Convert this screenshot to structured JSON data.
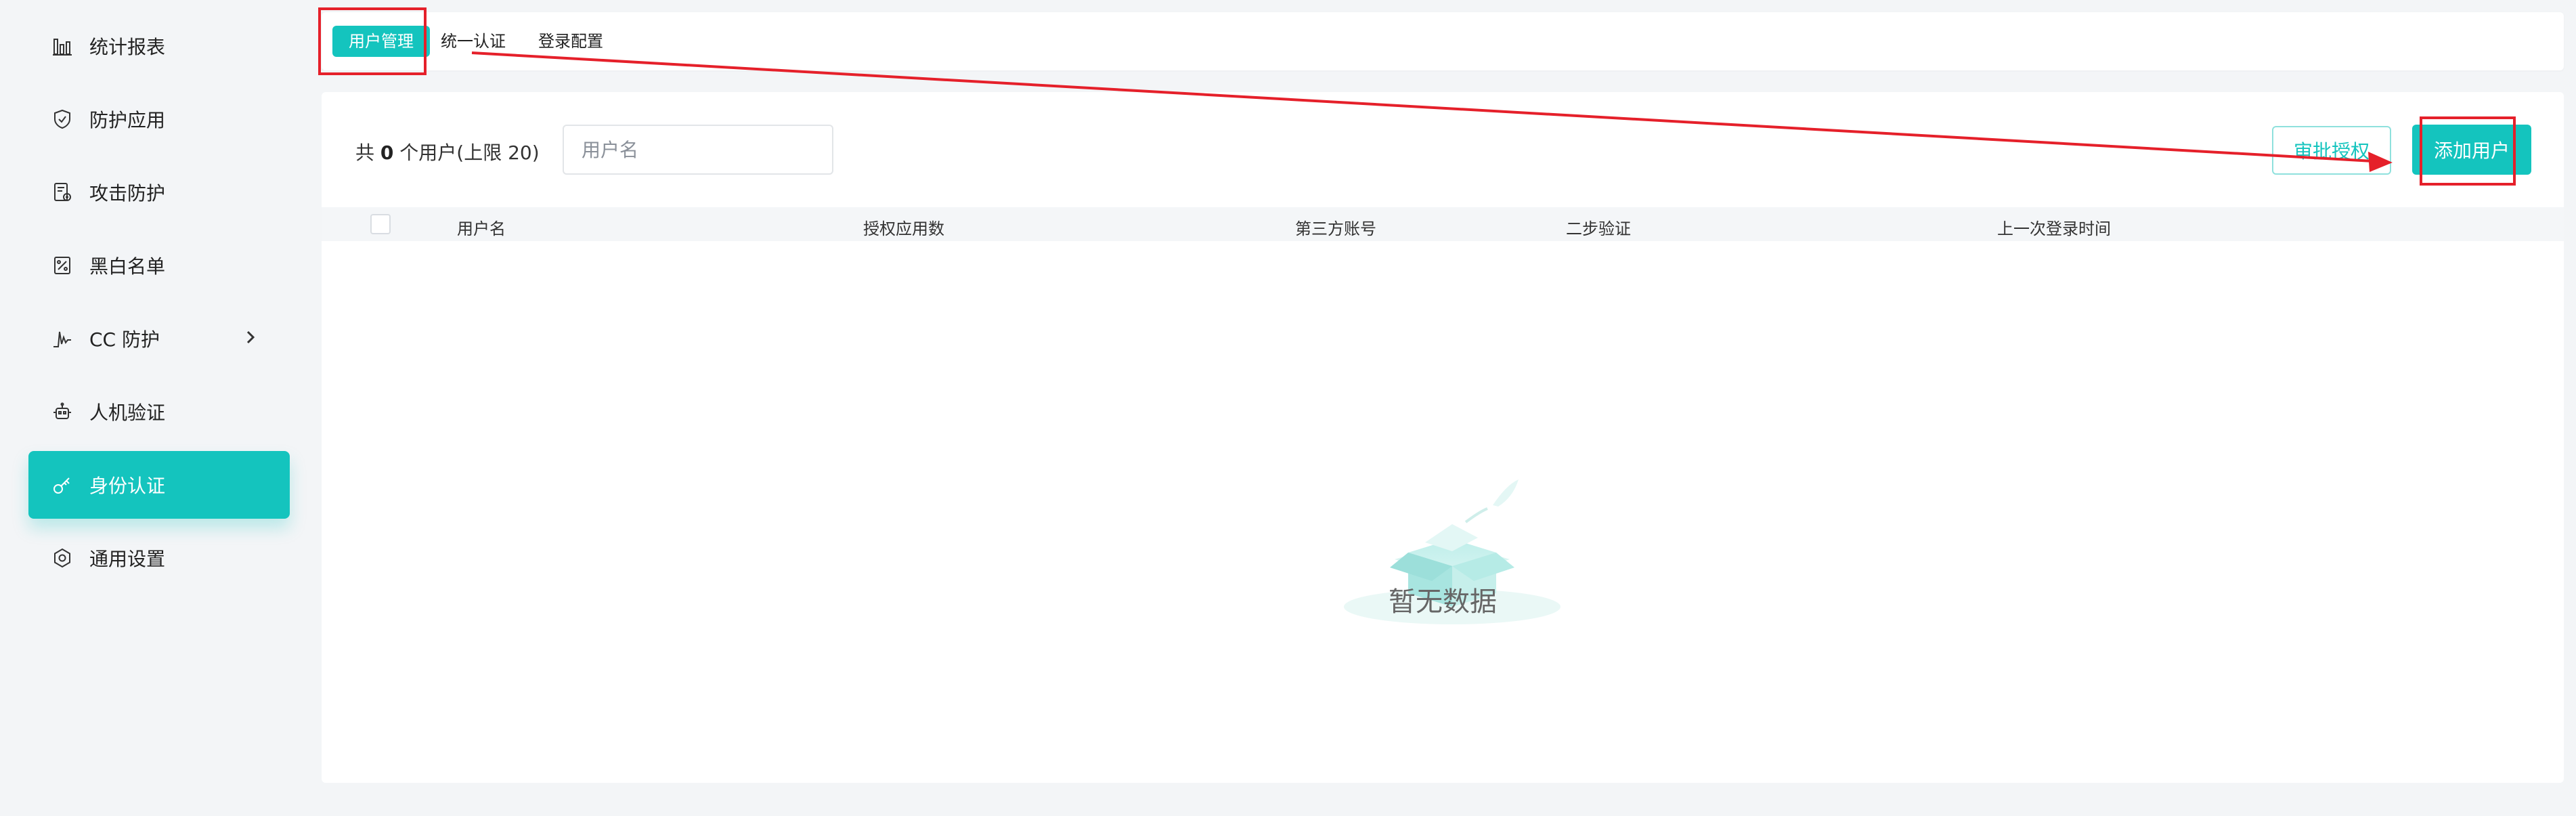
{
  "sidebar": {
    "items": [
      {
        "label": "统计报表",
        "icon": "bar-chart-icon"
      },
      {
        "label": "防护应用",
        "icon": "shield-check-icon"
      },
      {
        "label": "攻击防护",
        "icon": "attack-defense-icon"
      },
      {
        "label": "黑白名单",
        "icon": "percent-list-icon"
      },
      {
        "label": "CC 防护",
        "icon": "pulse-icon"
      },
      {
        "label": "人机验证",
        "icon": "robot-icon"
      },
      {
        "label": "身份认证",
        "icon": "key-icon"
      },
      {
        "label": "通用设置",
        "icon": "gear-icon"
      }
    ]
  },
  "tabs": {
    "user_management": "用户管理",
    "unified_auth": "统一认证",
    "login_config": "登录配置"
  },
  "toolbar": {
    "summary_prefix": "共 ",
    "summary_count": "0",
    "summary_suffix": " 个用户(上限 20)",
    "search_placeholder": "用户名",
    "approve_label": "审批授权",
    "add_user_label": "添加用户"
  },
  "table": {
    "columns": [
      "用户名",
      "授权应用数",
      "第三方账号",
      "二步验证",
      "上一次登录时间"
    ],
    "rows": []
  },
  "empty": {
    "text": "暂无数据"
  },
  "colors": {
    "accent": "#14c4be",
    "annotation": "#e5202a",
    "background": "#f3f5f7"
  }
}
